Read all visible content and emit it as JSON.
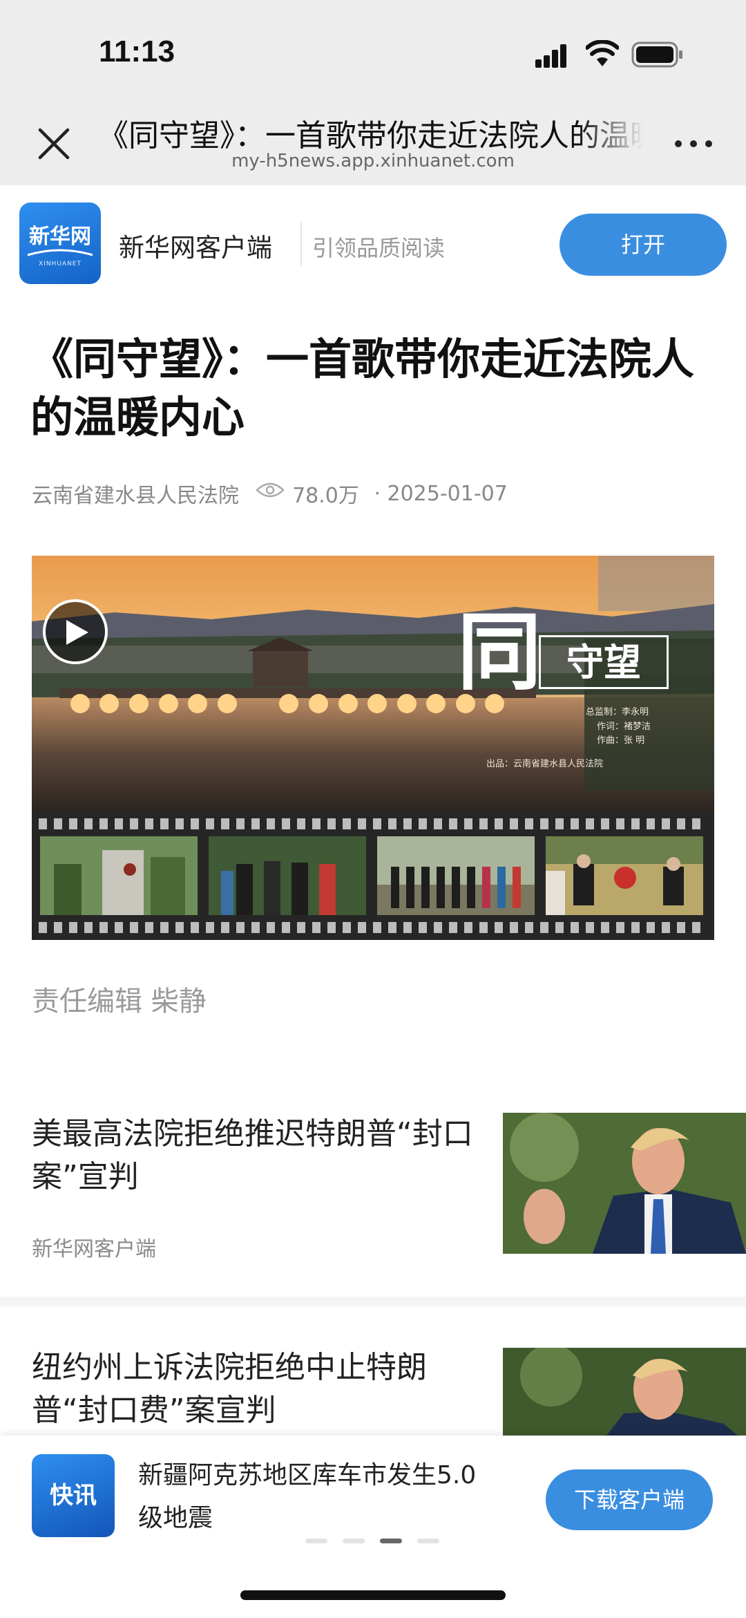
{
  "status_bar": {
    "time": "11:13"
  },
  "browser_bar": {
    "title": "《同守望》：一首歌带你走近法院人的温暖内心",
    "url": "my-h5news.app.xinhuanet.com"
  },
  "app_banner": {
    "logo_text": "新华网",
    "logo_sub": "XINHUANET",
    "name": "新华网客户端",
    "slogan": "引领品质阅读",
    "open_label": "打开"
  },
  "article": {
    "title": "《同守望》：一首歌带你走近法院人的温暖内心",
    "source": "云南省建水县人民法院",
    "views": "78.0万",
    "date": "· 2025-01-07",
    "video": {
      "title_big": "同",
      "title_small": "守望",
      "credits": [
        "总监制：李永明",
        "作词：褚梦洁",
        "作曲：张 明"
      ],
      "producer": "出品：云南省建水县人民法院"
    },
    "editor": "责任编辑 柴静"
  },
  "related": [
    {
      "title": "美最高法院拒绝推迟特朗普“封口案”宣判",
      "source": "新华网客户端"
    },
    {
      "title": "纽约州上诉法院拒绝中止特朗普“封口费”案宣判"
    }
  ],
  "popup": {
    "logo_text": "快讯",
    "text": "新疆阿克苏地区库车市发生5.0级地震",
    "download_label": "下载客户端",
    "page_count": 4,
    "active_page": 3
  },
  "colors": {
    "accent": "#3a8ee0",
    "browser_bg": "#ededed",
    "meta_text": "#888888"
  }
}
